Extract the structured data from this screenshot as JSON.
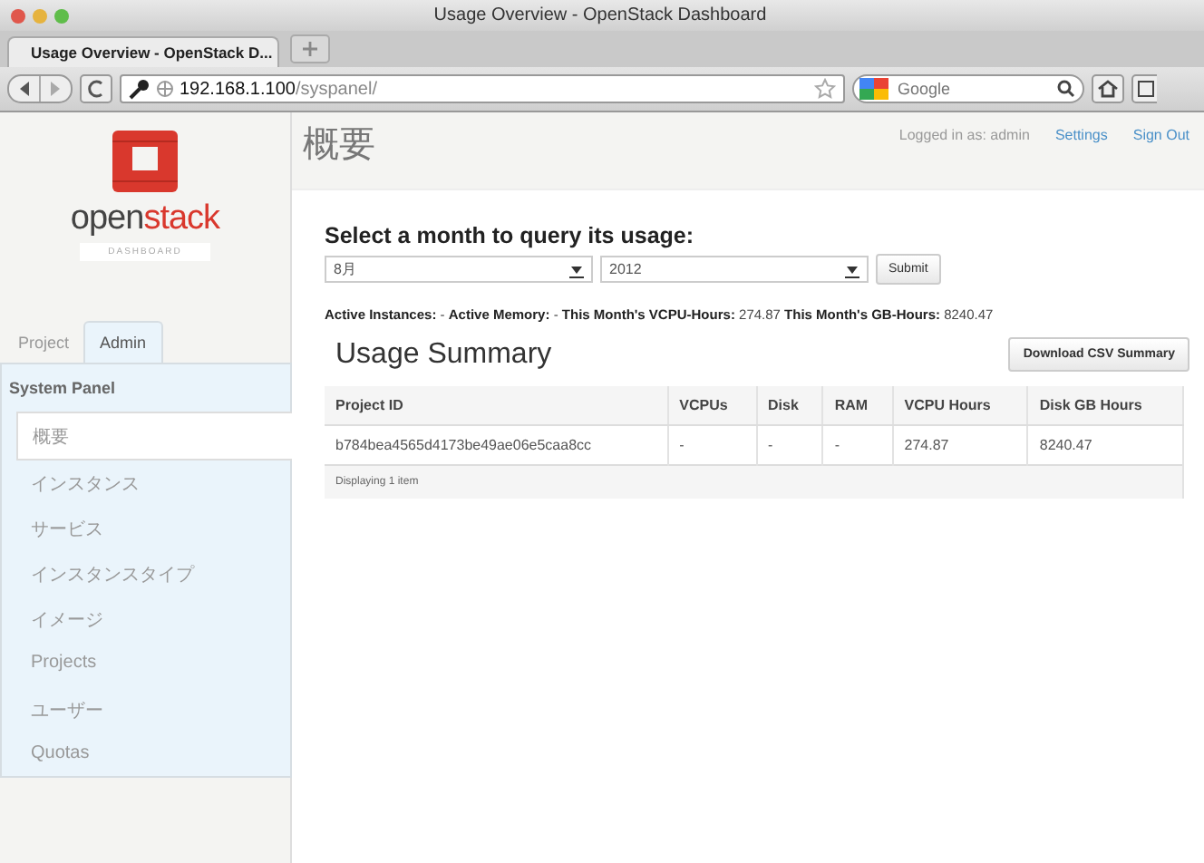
{
  "browser": {
    "window_title": "Usage Overview - OpenStack Dashboard",
    "tab_title": "Usage Overview - OpenStack D...",
    "url_host": "192.168.1.100",
    "url_path": "/syspanel/",
    "search_placeholder": "Google"
  },
  "sidebar": {
    "logo": {
      "prefix": "open",
      "suffix": "stack",
      "subtitle": "DASHBOARD"
    },
    "tabs": [
      {
        "label": "Project",
        "selected": false
      },
      {
        "label": "Admin",
        "selected": true
      }
    ],
    "panel_title": "System Panel",
    "items": [
      {
        "label": "概要",
        "selected": true
      },
      {
        "label": "インスタンス",
        "selected": false
      },
      {
        "label": "サービス",
        "selected": false
      },
      {
        "label": "インスタンスタイプ",
        "selected": false
      },
      {
        "label": "イメージ",
        "selected": false
      },
      {
        "label": "Projects",
        "selected": false
      },
      {
        "label": "ユーザー",
        "selected": false
      },
      {
        "label": "Quotas",
        "selected": false
      }
    ]
  },
  "header": {
    "title": "概要",
    "user_text": "Logged in as: admin",
    "links": [
      "Settings",
      "Sign Out"
    ]
  },
  "form": {
    "heading": "Select a month to query its usage:",
    "month": "8月",
    "year": "2012",
    "submit": "Submit"
  },
  "stats": "**Active Instances:** - **Active Memory:** - **This Month's VCPU-Hours:** 274.87 **This Month's GB-Hours:** 8240.47",
  "summary": {
    "title": "Usage Summary",
    "download_button": "Download CSV Summary",
    "columns": [
      "Project ID",
      "VCPUs",
      "Disk",
      "RAM",
      "VCPU Hours",
      "Disk GB Hours"
    ],
    "rows": [
      [
        "b784bea4565d4173be49ae06e5caa8cc",
        "-",
        "-",
        "-",
        "274.87",
        "8240.47"
      ]
    ],
    "footer": "Displaying 1 item"
  }
}
